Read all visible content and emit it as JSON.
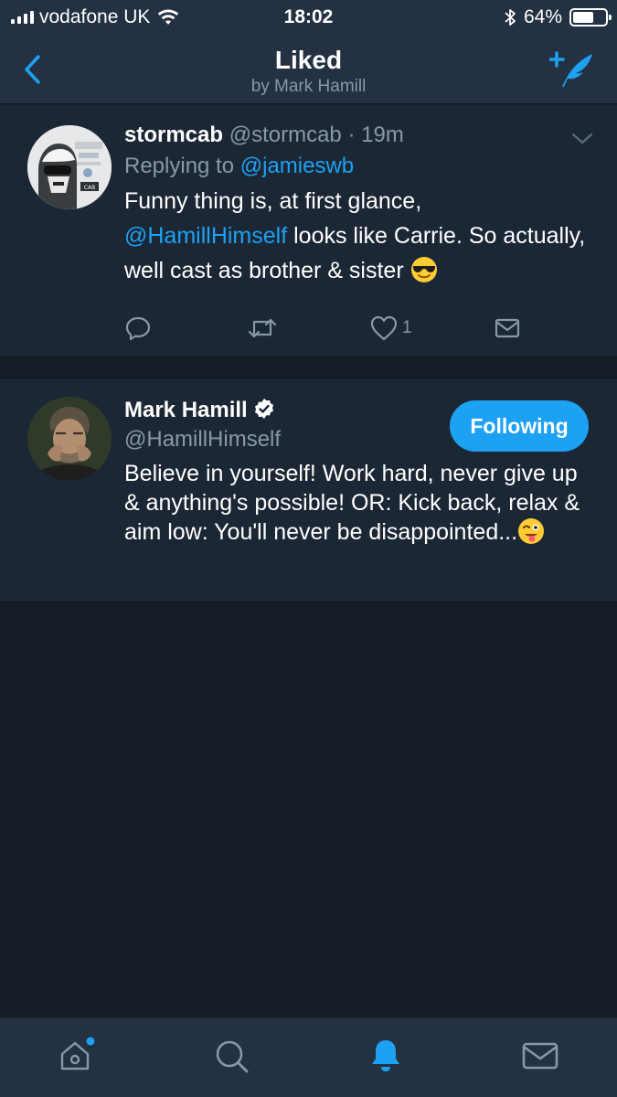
{
  "status_bar": {
    "carrier": "vodafone UK",
    "time": "18:02",
    "battery_percent_label": "64%",
    "battery_level": 0.64,
    "icons": [
      "signal-icon",
      "wifi-icon",
      "bluetooth-icon",
      "battery-icon"
    ]
  },
  "nav": {
    "title": "Liked",
    "subtitle": "by Mark Hamill",
    "back_icon": "chevron-left-icon",
    "compose_icon": "compose-tweet-icon"
  },
  "tweets": [
    {
      "name": "stormcab",
      "handle": "@stormcab",
      "separator": "·",
      "time": "19m",
      "reply_prefix": "Replying to ",
      "reply_to": "@jamieswb",
      "mention": "@HamillHimself",
      "text_before": "Funny thing is, at first glance, ",
      "text_after": " looks like Carrie. So actually, well cast as brother & sister ",
      "emoji": "smiling-face-with-sunglasses",
      "reply_icon": "reply-icon",
      "retweet_icon": "retweet-icon",
      "like_icon": "heart-icon",
      "like_count": "1",
      "dm_icon": "envelope-icon"
    },
    {
      "name": "Mark Hamill",
      "handle": "@HamillHimself",
      "verified": true,
      "follow_label": "Following",
      "text": "Believe in yourself! Work hard, never give up & anything's possible! OR: Kick back, relax & aim low: You'll never be disappointed...",
      "emoji": "winking-face-with-tongue"
    }
  ],
  "tab_bar": {
    "tabs": [
      "home-icon",
      "search-icon",
      "notifications-icon",
      "messages-icon"
    ],
    "active": "notifications-icon"
  },
  "colors": {
    "accent": "#1da1f2",
    "bar_background": "#233142",
    "card_background": "#1c2735",
    "page_background": "#151d27",
    "secondary_text": "#8899a6"
  }
}
